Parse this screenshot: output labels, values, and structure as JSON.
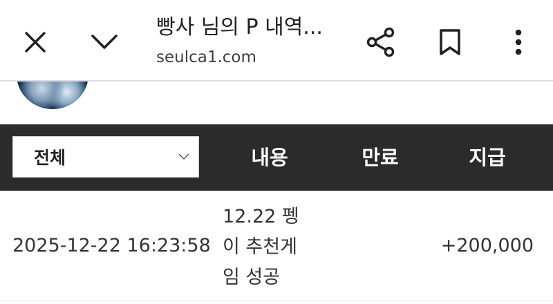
{
  "toolbar": {
    "title": "빵사 님의 P 내역...",
    "url": "seulca1.com",
    "icons": {
      "close": "close-icon",
      "minimize": "chevron-down-icon",
      "share": "share-icon",
      "bookmark": "bookmark-icon",
      "more": "more-vertical-icon"
    }
  },
  "table": {
    "filter": {
      "selected": "전체"
    },
    "headers": {
      "content": "내용",
      "expire": "만료",
      "paid": "지급"
    },
    "rows": [
      {
        "date": "2025-12-22 16:23:58",
        "content_lines": [
          "12.22 펭",
          "이 추천게",
          "임 성공"
        ],
        "expire": "",
        "amount": "+200,000"
      }
    ]
  },
  "colors": {
    "header_bg": "#2b2b2b",
    "header_text": "#ffffff",
    "body_text": "#333333"
  }
}
